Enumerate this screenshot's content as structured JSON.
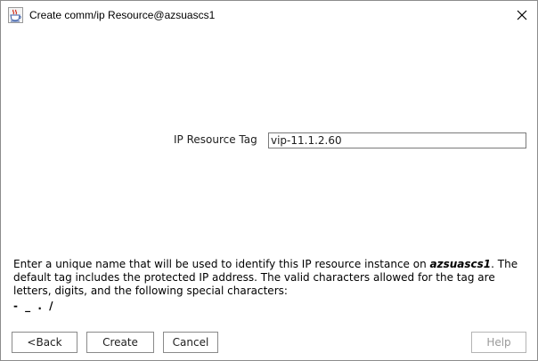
{
  "window": {
    "title": "Create comm/ip Resource@azsuascs1"
  },
  "form": {
    "label": "IP Resource Tag",
    "value": "vip-11.1.2.60"
  },
  "help": {
    "text_before": "Enter a unique name that will be used to identify this IP resource instance on ",
    "host": "azsuascs1",
    "text_after": ". The default tag includes the protected IP address. The valid characters allowed for the tag are letters, digits, and the following special characters:",
    "special_chars": "- _ . /"
  },
  "buttons": {
    "back": "<Back",
    "create": "Create",
    "cancel": "Cancel",
    "help": "Help"
  },
  "icons": {
    "title_icon": "java-cup-icon",
    "close_icon": "close-icon"
  }
}
